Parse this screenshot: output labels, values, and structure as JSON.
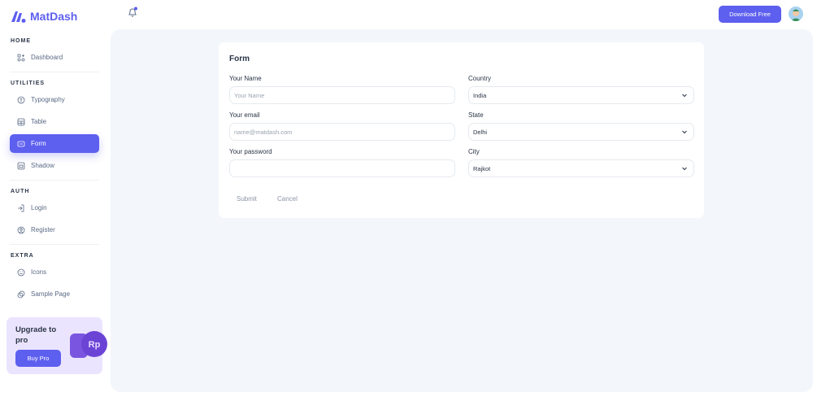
{
  "brand": "MatDash",
  "header": {
    "download_label": "Download Free"
  },
  "sidebar": {
    "sections": [
      "HOME",
      "UTILITIES",
      "AUTH",
      "EXTRA"
    ],
    "items": [
      {
        "label": "Dashboard"
      },
      {
        "label": "Typography"
      },
      {
        "label": "Table"
      },
      {
        "label": "Form"
      },
      {
        "label": "Shadow"
      },
      {
        "label": "Login"
      },
      {
        "label": "Register"
      },
      {
        "label": "Icons"
      },
      {
        "label": "Sample Page"
      }
    ],
    "upgrade": {
      "title": "Upgrade to pro",
      "button": "Buy Pro",
      "coin_text": "Rp"
    }
  },
  "form": {
    "title": "Form",
    "name": {
      "label": "Your Name",
      "placeholder": "Your Name"
    },
    "email": {
      "label": "Your email",
      "placeholder": "name@matdash.com"
    },
    "password": {
      "label": "Your password",
      "value": ""
    },
    "country": {
      "label": "Country",
      "value": "India"
    },
    "state": {
      "label": "State",
      "value": "Delhi"
    },
    "city": {
      "label": "City",
      "value": "Rajkot"
    },
    "submit": "Submit",
    "cancel": "Cancel"
  },
  "colors": {
    "accent": "#5d5fef",
    "background": "#f3f6fb"
  }
}
